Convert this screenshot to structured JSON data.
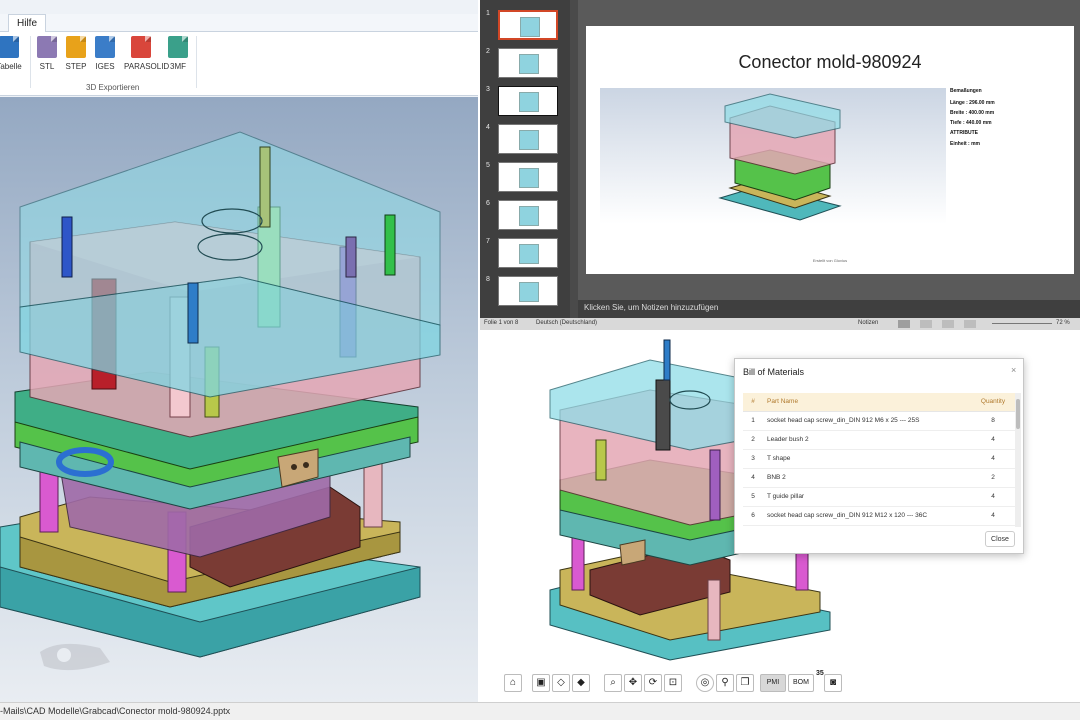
{
  "left_app": {
    "tabs": [
      "Hilfe"
    ],
    "buttons": [
      {
        "label": "Tabelle",
        "color": "#2f74c0"
      },
      {
        "label": "STL",
        "color": "#8c79b3"
      },
      {
        "label": "STEP",
        "color": "#e8a21a"
      },
      {
        "label": "IGES",
        "color": "#3b7dc8"
      },
      {
        "label": "PARASOLID",
        "color": "#d9463b"
      },
      {
        "label": "3MF",
        "color": "#3aa08a"
      }
    ],
    "group_label": "3D Exportieren"
  },
  "ppt": {
    "slide_numbers": [
      "1",
      "2",
      "3",
      "4",
      "5",
      "6",
      "7",
      "8"
    ],
    "slide_title": "Conector mold-980924",
    "meta": [
      "Bemaßungen",
      "Länge : 296.00 mm",
      "Breite : 400.00 mm",
      "Tiefe : 440.00 mm",
      "ATTRIBUTE",
      "Einheit : mm"
    ],
    "slide_footer": "Erstellt von Glovius",
    "notes_placeholder": "Klicken Sie, um Notizen hinzuzufügen",
    "status_slide": "Folie 1 von 8",
    "status_language": "Deutsch (Deutschland)",
    "status_notes": "Notizen",
    "zoom": "72 %"
  },
  "bom": {
    "title": "Bill of Materials",
    "close_x": "×",
    "headers": [
      "#",
      "Part Name",
      "Quantity"
    ],
    "rows": [
      [
        "1",
        "socket head cap screw_din_DIN 912 M6 x 25 --- 25S",
        "8"
      ],
      [
        "2",
        "Leader bush 2",
        "4"
      ],
      [
        "3",
        "T shape",
        "4"
      ],
      [
        "4",
        "BNB 2",
        "2"
      ],
      [
        "5",
        "T guide pillar",
        "4"
      ],
      [
        "6",
        "socket head cap screw_din_DIN 912 M12 x 120 --- 36C",
        "4"
      ]
    ],
    "close_label": "Close"
  },
  "toolbar": {
    "home": "⌂",
    "zoom": "⌕",
    "pan": "✥",
    "rotate": "⟳",
    "pmi": "PMI",
    "bom": "BOM",
    "bom_count": "35"
  },
  "path": "-Mails\\CAD Modelle\\Grabcad\\Conector mold-980924.pptx"
}
